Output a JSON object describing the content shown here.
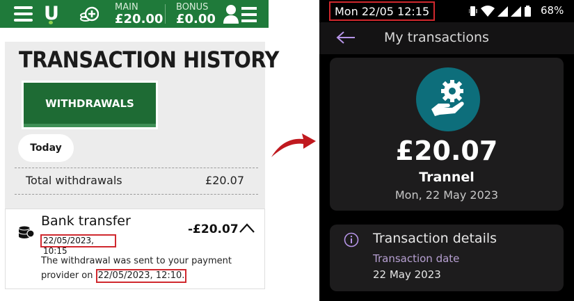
{
  "left": {
    "logo": "U",
    "balances": [
      {
        "label": "MAIN",
        "value": "£20.00"
      },
      {
        "label": "BONUS",
        "value": "£0.00"
      }
    ],
    "title": "TRANSACTION HISTORY",
    "tab_label": "WITHDRAWALS",
    "filter_label": "Today",
    "total_label": "Total withdrawals",
    "total_value": "£20.07",
    "item": {
      "title": "Bank transfer",
      "amount": "-£20.07",
      "datetime": "22/05/2023, 10:15",
      "desc_line1": "The withdrawal was sent to your payment",
      "desc_line2_prefix": "provider on ",
      "sent_datetime": "22/05/2023, 12:10."
    }
  },
  "right": {
    "status_time": "Mon 22/05 12:15",
    "battery": "68%",
    "screen_title": "My transactions",
    "amount": "£20.07",
    "merchant": "Trannel",
    "date": "Mon, 22 May 2023",
    "details_title": "Transaction details",
    "details_label": "Transaction date",
    "details_value": "22 May 2023"
  },
  "colors": {
    "left_brand_green": "#1f7a3a",
    "highlight_red": "#d0282e",
    "merchant_logo_teal": "#0d6e7b",
    "accent_purple": "#b7a0d2"
  },
  "icons": [
    "hamburger-icon",
    "wallet-plus-icon",
    "account-menu-icon",
    "coins-icon",
    "chevron-up-icon",
    "arrow-icon",
    "vibrate-icon",
    "wifi-icon",
    "signal-icon",
    "battery-icon",
    "back-arrow-icon",
    "gear-hand-icon",
    "info-icon"
  ]
}
